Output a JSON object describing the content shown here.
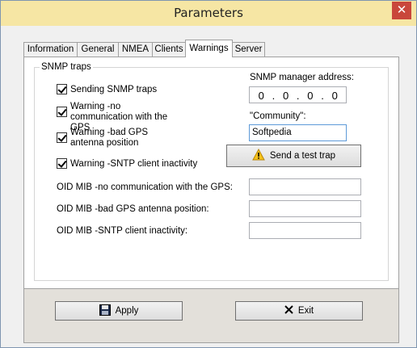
{
  "window": {
    "title": "Parameters",
    "close_glyph": "✕"
  },
  "tabs": [
    {
      "label": "Information"
    },
    {
      "label": "General"
    },
    {
      "label": "NMEA"
    },
    {
      "label": "Clients"
    },
    {
      "label": "Warnings"
    },
    {
      "label": "Server"
    }
  ],
  "active_tab": "Warnings",
  "snmp": {
    "group_title": "SNMP traps",
    "checkboxes": [
      {
        "label": "Sending SNMP traps",
        "checked": true
      },
      {
        "label": "Warning -no communication with the GPS",
        "checked": true
      },
      {
        "label": "Warning -bad GPS antenna position",
        "checked": true
      },
      {
        "label": "Warning -SNTP client inactivity",
        "checked": true
      }
    ],
    "manager_address_label": "SNMP manager address:",
    "manager_address_octets": [
      "0",
      "0",
      "0",
      "0"
    ],
    "community_label": "\"Community\":",
    "community_value": "Softpedia",
    "send_test_trap_label": "Send a test trap",
    "oid_fields": [
      {
        "label": "OID MIB -no communication with the GPS:",
        "value": ""
      },
      {
        "label": "OID MIB -bad GPS antenna position:",
        "value": ""
      },
      {
        "label": "OID MIB -SNTP client inactivity:",
        "value": ""
      }
    ]
  },
  "footer": {
    "apply_label": "Apply",
    "exit_label": "Exit"
  },
  "icons": {
    "close": "close-icon",
    "warning": "warning-icon",
    "save": "floppy-disk-icon",
    "exit": "x-icon"
  }
}
